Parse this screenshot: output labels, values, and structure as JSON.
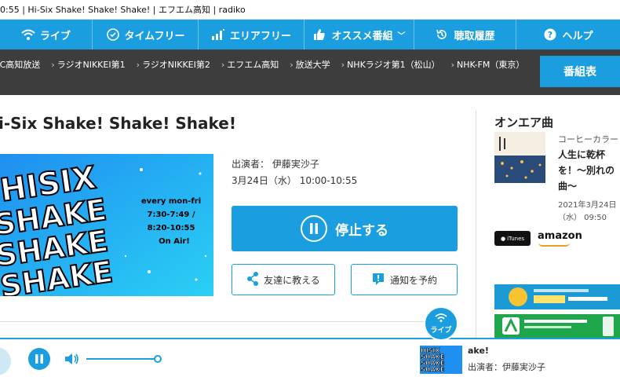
{
  "window": {
    "title": "0:55 | Hi-Six Shake! Shake! Shake! | エフエム高知 | radiko"
  },
  "nav": {
    "items": [
      {
        "label": "ライブ",
        "icon": "wifi-icon"
      },
      {
        "label": "タイムフリー",
        "icon": "clock-check-icon"
      },
      {
        "label": "エリアフリー",
        "icon": "signal-bars-icon"
      },
      {
        "label": "オススメ番組",
        "icon": "thumbs-up-icon"
      },
      {
        "label": "聴取履歴",
        "icon": "history-icon"
      },
      {
        "label": "ヘルプ",
        "icon": "help-icon"
      }
    ]
  },
  "stations": [
    "KC高知放送",
    "ラジオNIKKEI第1",
    "ラジオNIKKEI第2",
    "エフエム高知",
    "放送大学",
    "NHKラジオ第1（松山）",
    "NHK-FM（東京）"
  ],
  "timetable_label": "番組表",
  "program": {
    "title": "i-Six Shake! Shake! Shake!",
    "performer": "出演者：  伊藤実沙子",
    "datetime": "3月24日（水）  10:00-10:55",
    "stop_label": "停止する",
    "share_label": "友達に教える",
    "notify_label": "通知を予約",
    "image_text": {
      "logo": [
        "HISIX",
        "SHAKE",
        "SHAKE",
        "SHAKE"
      ],
      "schedule": [
        "every mon-fri",
        "7:30-7:49 /",
        "8:20-10:55",
        "On Air!"
      ]
    }
  },
  "onair": {
    "heading": "オンエア曲",
    "artist": "コーヒーカラー",
    "song": "人生に乾杯を！～別れの曲～",
    "date_line1": "2021年3月24日",
    "date_line2": "（水） 09:50",
    "itunes_label": "iTunes",
    "amazon_label": "amazon"
  },
  "live_badge": "ライブ",
  "player": {
    "title": "ake!",
    "performer": "出演者：伊藤実沙子"
  },
  "colors": {
    "brand": "#1a9ee0",
    "dark_bar": "#3d3d3d"
  }
}
